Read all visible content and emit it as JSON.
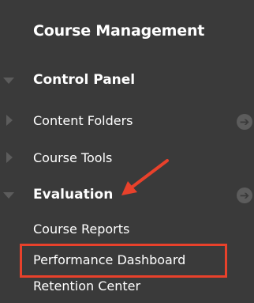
{
  "panel": {
    "title": "Course Management",
    "items": [
      {
        "label": "Control Panel",
        "expanded": true,
        "icon": "triangle-down-icon"
      },
      {
        "label": "Content Folders",
        "expanded": false,
        "icon": "triangle-right-icon",
        "action_icon": "circle-arrow-icon"
      },
      {
        "label": "Course Tools",
        "expanded": false,
        "icon": "triangle-right-icon"
      },
      {
        "label": "Evaluation",
        "expanded": true,
        "icon": "triangle-down-icon",
        "action_icon": "circle-arrow-icon"
      }
    ],
    "evaluation_subitems": [
      {
        "label": "Course Reports"
      },
      {
        "label": "Performance Dashboard"
      },
      {
        "label": "Retention Center"
      }
    ]
  },
  "colors": {
    "background": "#3a3a3a",
    "text": "#ffffff",
    "icon": "#5c5c5c",
    "annotation": "#e8412b"
  }
}
